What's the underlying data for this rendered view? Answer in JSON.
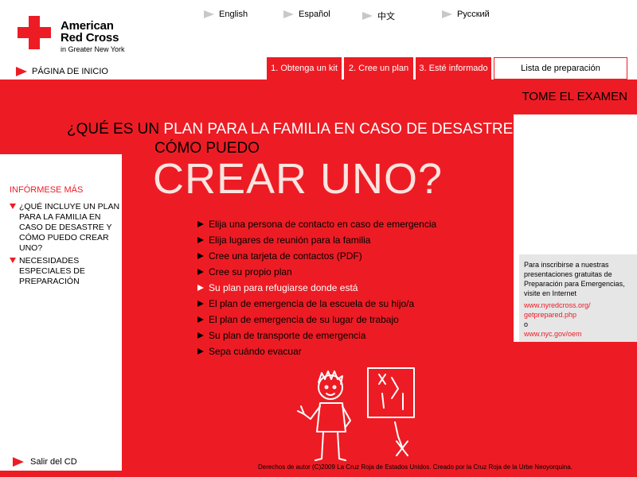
{
  "brand": {
    "name_line1": "American",
    "name_line2": "Red Cross",
    "subtitle": "in Greater New York"
  },
  "languages": [
    "English",
    "Español",
    "中文",
    "Русский"
  ],
  "home_label": "PÁGINA DE INICIO",
  "tabs": [
    "1. Obtenga un kit",
    "2. Cree un plan",
    "3. Esté informado",
    "Lista de preparación"
  ],
  "exam": {
    "part1": "TOME EL",
    "part2": "EXAMEN"
  },
  "heading": {
    "line1_a": "¿QUÉ ES UN",
    "line1_b": "PLAN PARA LA FAMILIA EN CASO DE DESASTRE Y",
    "line2": "CÓMO PUEDO",
    "big": "CREAR UNO?"
  },
  "sidebar": {
    "title": "INFÓRMESE MÁS",
    "items": [
      "¿QUÉ INCLUYE UN PLAN PARA LA FAMILIA EN CASO DE DESASTRE Y CÓMO PUEDO CREAR UNO?",
      "NECESIDADES ESPECIALES DE PREPARACIÓN"
    ]
  },
  "bullets": [
    "Elija una persona de contacto en caso de emergencia",
    "Elija lugares de reunión para la familia",
    "Cree una tarjeta de contactos (PDF)",
    "Cree su propio plan",
    "Su plan para refugiarse donde está",
    "El plan de emergencia de la escuela de su hijo/a",
    "El plan de emergencia de su lugar de trabajo",
    "Su plan de transporte de emergencia",
    "Sepa cuándo evacuar"
  ],
  "active_bullet_index": 4,
  "info_box": {
    "text": "Para inscribirse a nuestras presentaciones gratuitas de Preparación para Emergencias, visite en Internet",
    "link1a": "www.nyredcross.org/",
    "link1b": "getprepared.php",
    "or": "o",
    "link2": "www.nyc.gov/oem"
  },
  "exit_label": "Salir del CD",
  "copyright": "Derechos de autor (C)2009 La Cruz Roja de Estados Unidos. Creado por la Cruz Roja de la Urbe Neoyorquina.",
  "colors": {
    "brand_red": "#ed1c24",
    "panel_gray": "#e6e6e6"
  }
}
